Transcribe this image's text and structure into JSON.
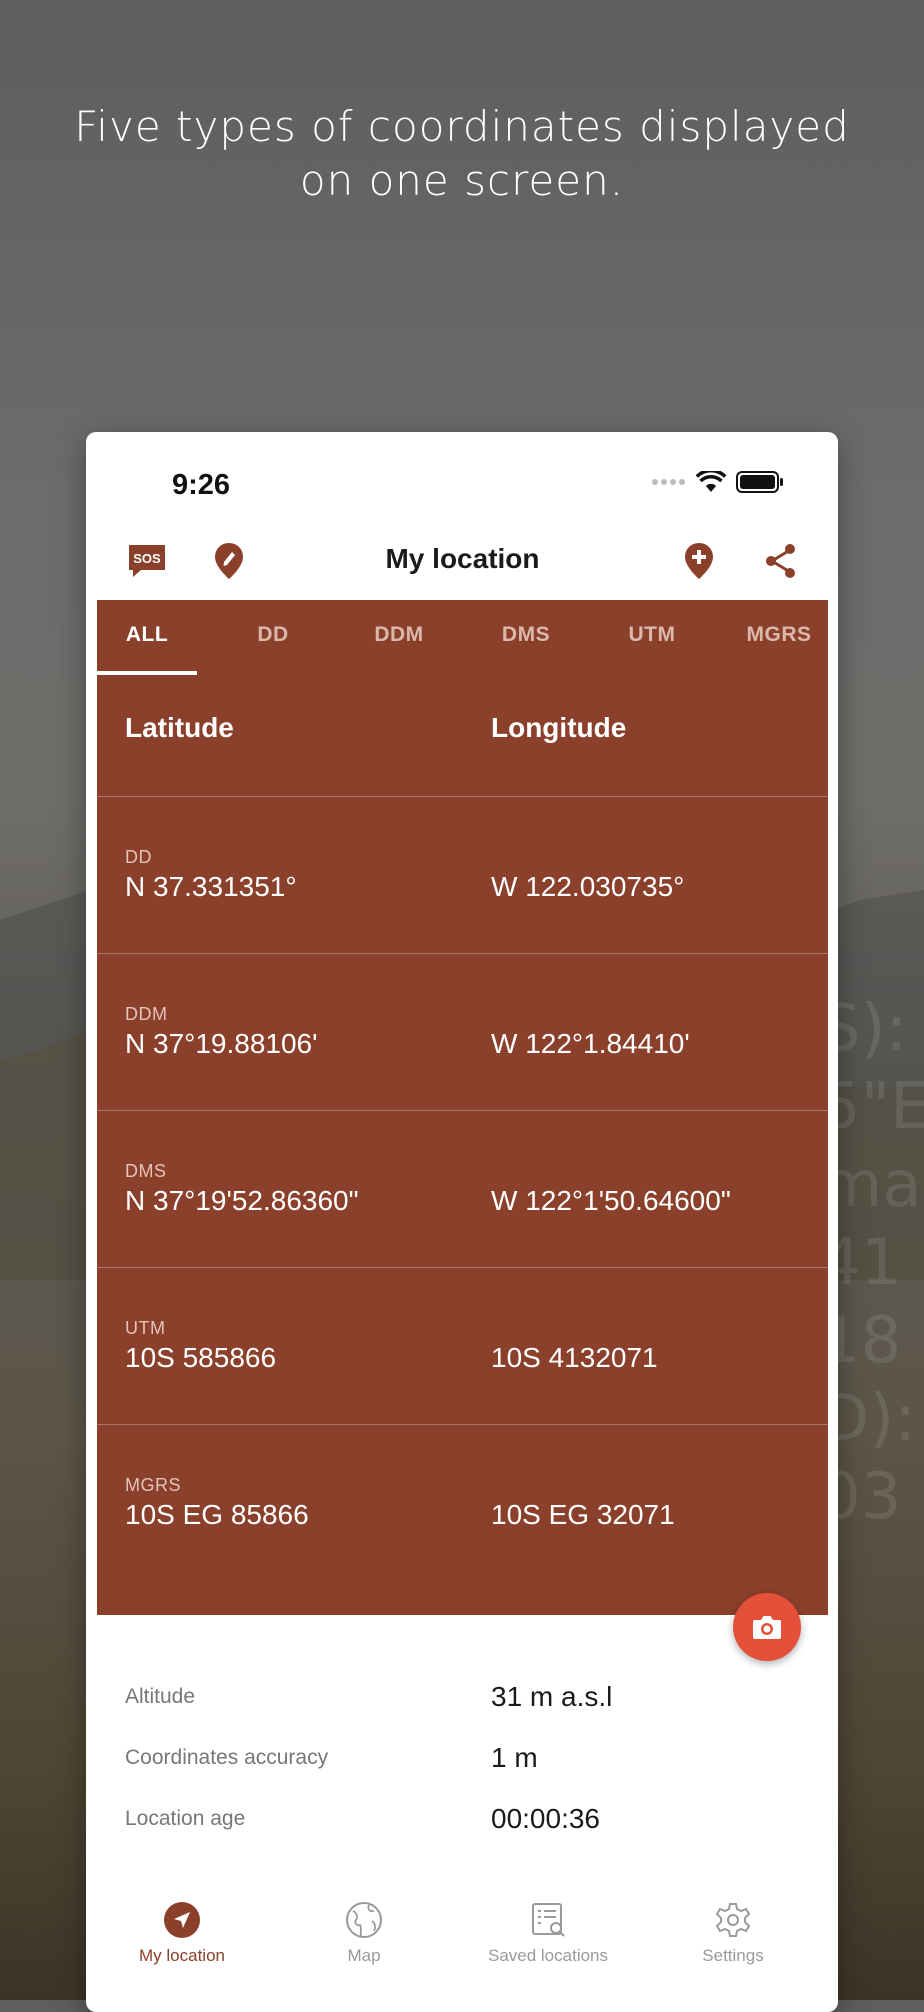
{
  "headline": {
    "line1": "Five types of coordinates displayed",
    "line2": "on one screen."
  },
  "background": {
    "ghost_lines": [
      "S):",
      "5\"E",
      "mal",
      "41",
      "18",
      "D):",
      "03"
    ]
  },
  "status_bar": {
    "time": "9:26"
  },
  "header": {
    "title": "My location",
    "sos_label": "SOS"
  },
  "tabs": [
    {
      "label": "ALL",
      "active": true
    },
    {
      "label": "DD"
    },
    {
      "label": "DDM"
    },
    {
      "label": "DMS"
    },
    {
      "label": "UTM"
    },
    {
      "label": "MGRS"
    }
  ],
  "columns": {
    "latitude": "Latitude",
    "longitude": "Longitude"
  },
  "rows": [
    {
      "label": "DD",
      "lat": "N 37.331351°",
      "lon": "W 122.030735°"
    },
    {
      "label": "DDM",
      "lat": "N 37°19.88106'",
      "lon": "W 122°1.84410'"
    },
    {
      "label": "DMS",
      "lat": "N 37°19'52.86360\"",
      "lon": "W 122°1'50.64600\""
    },
    {
      "label": "UTM",
      "lat": "10S 585866",
      "lon": "10S 4132071"
    },
    {
      "label": "MGRS",
      "lat": "10S EG 85866",
      "lon": "10S EG 32071"
    }
  ],
  "info": [
    {
      "label": "Altitude",
      "value": "31 m a.s.l"
    },
    {
      "label": "Coordinates accuracy",
      "value": "1 m"
    },
    {
      "label": "Location age",
      "value": "00:00:36"
    }
  ],
  "nav": [
    {
      "label": "My location",
      "icon": "navigation-arrow-icon",
      "active": true
    },
    {
      "label": "Map",
      "icon": "globe-icon"
    },
    {
      "label": "Saved locations",
      "icon": "saved-list-icon"
    },
    {
      "label": "Settings",
      "icon": "gear-icon"
    }
  ],
  "colors": {
    "accent": "#8a402b",
    "fab": "#e4503a",
    "tab_inactive": "#dcb8ab"
  }
}
